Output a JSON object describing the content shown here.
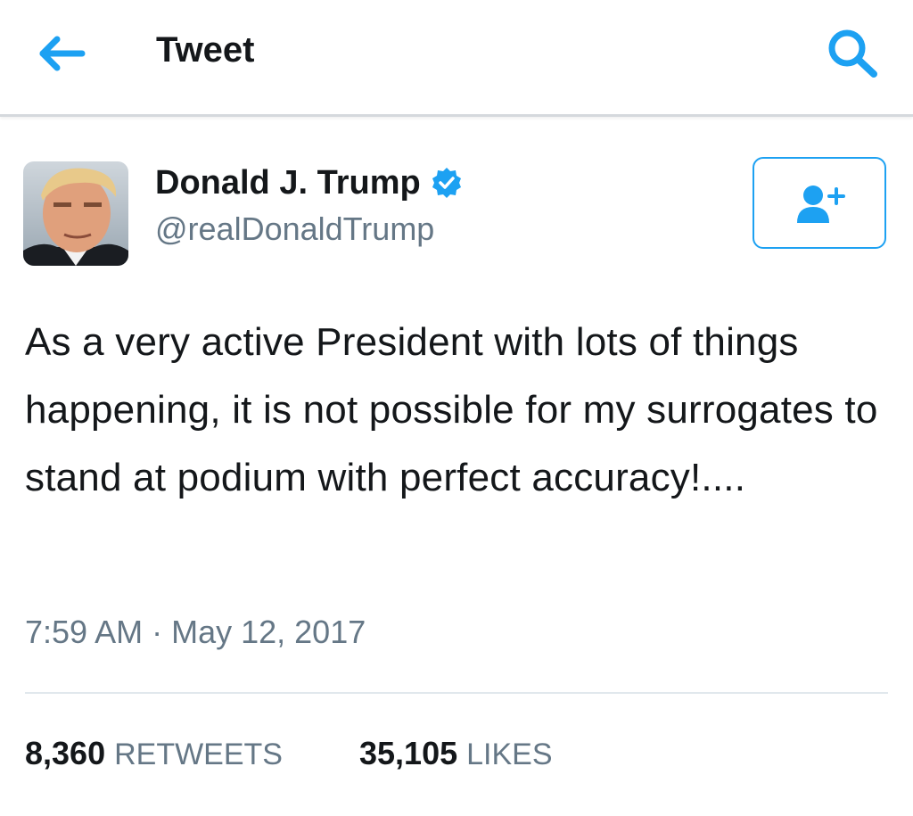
{
  "header": {
    "title": "Tweet",
    "back_icon": "back-arrow-icon",
    "search_icon": "search-icon",
    "accent": "#1da1f2"
  },
  "author": {
    "display_name": "Donald J. Trump",
    "handle": "@realDonaldTrump",
    "verified": true,
    "avatar_icon": "profile-photo"
  },
  "follow_button": {
    "icon": "follow-user-plus-icon"
  },
  "tweet": {
    "text": "As a very active President with lots of things happening, it is not possible for my surrogates to stand at podium with perfect accuracy!....",
    "time": "7:59 AM",
    "separator": "·",
    "date": "May 12, 2017"
  },
  "stats": {
    "retweets_count": "8,360",
    "retweets_label": "RETWEETS",
    "likes_count": "35,105",
    "likes_label": "LIKES"
  },
  "colors": {
    "text": "#14171a",
    "secondary": "#657786",
    "divider": "#e1e8ed"
  }
}
